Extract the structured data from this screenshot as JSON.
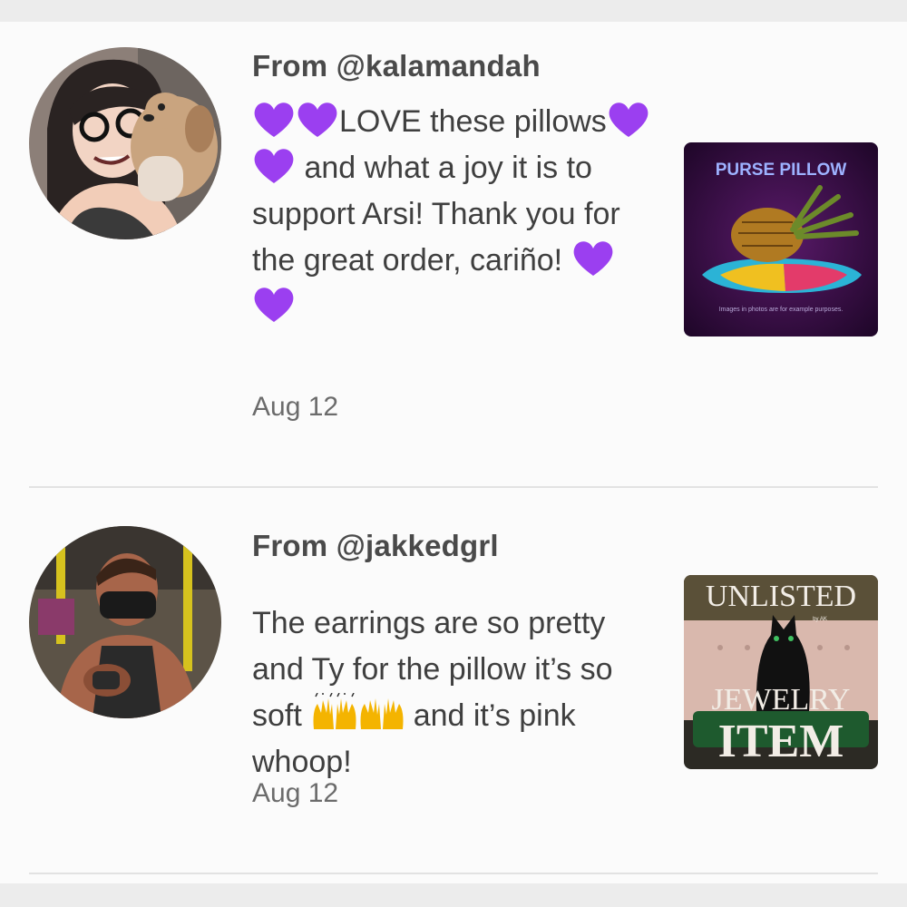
{
  "reviews": [
    {
      "from": "From @kalamandah",
      "message": {
        "part1": "LOVE these pillows",
        "part2": " and what a joy it is to support Arsi! Thank you for the great order, cariño! "
      },
      "date": "Aug 12",
      "thumbnail": {
        "title": "PURSE PILLOW",
        "caption": "Images in photos are for example purposes."
      }
    },
    {
      "from": "From @jakkedgrl",
      "message": {
        "part1": "The earrings are so pretty and Ty for the pillow it’s so soft ",
        "part2": " and it’s pink whoop!"
      },
      "date": "Aug 12",
      "thumbnail": {
        "line1": "UNLISTED",
        "small": "by AK",
        "line2": "JEWELRY",
        "line3": "ITEM"
      }
    }
  ],
  "colors": {
    "heart": "#9b3ff0",
    "thumb1_bg": "#3a0d4a",
    "thumb1_title": "#9db2ff"
  },
  "icons": [
    "purple-heart-icon",
    "raising-hands-icon"
  ]
}
